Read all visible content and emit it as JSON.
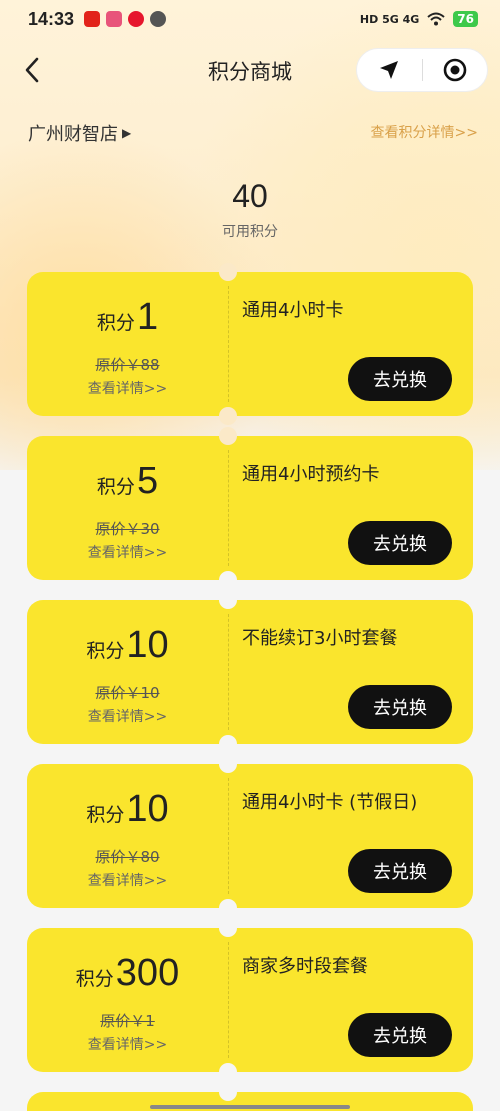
{
  "status_bar": {
    "time": "14:33",
    "network": "HD 5G 4G",
    "battery": "76"
  },
  "nav": {
    "title": "积分商城"
  },
  "store": {
    "name": "广州财智店",
    "points_detail_link": "查看积分详情>>"
  },
  "points": {
    "value": "40",
    "label": "可用积分"
  },
  "coupons": [
    {
      "prefix": "积分",
      "cost": "1",
      "name": "通用4小时卡",
      "original_price": "原价￥88",
      "detail_link": "查看详情>>",
      "button": "去兑换"
    },
    {
      "prefix": "积分",
      "cost": "5",
      "name": "通用4小时预约卡",
      "original_price": "原价￥30",
      "detail_link": "查看详情>>",
      "button": "去兑换"
    },
    {
      "prefix": "积分",
      "cost": "10",
      "name": "不能续订3小时套餐",
      "original_price": "原价￥10",
      "detail_link": "查看详情>>",
      "button": "去兑换"
    },
    {
      "prefix": "积分",
      "cost": "10",
      "name": "通用4小时卡 (节假日)",
      "original_price": "原价￥80",
      "detail_link": "查看详情>>",
      "button": "去兑换"
    },
    {
      "prefix": "积分",
      "cost": "300",
      "name": "商家多时段套餐",
      "original_price": "原价￥1",
      "detail_link": "查看详情>>",
      "button": "去兑换"
    }
  ],
  "colors": {
    "coupon_bg": "#fae52d",
    "button_bg": "#111111",
    "link_gold": "#d9a14a"
  }
}
